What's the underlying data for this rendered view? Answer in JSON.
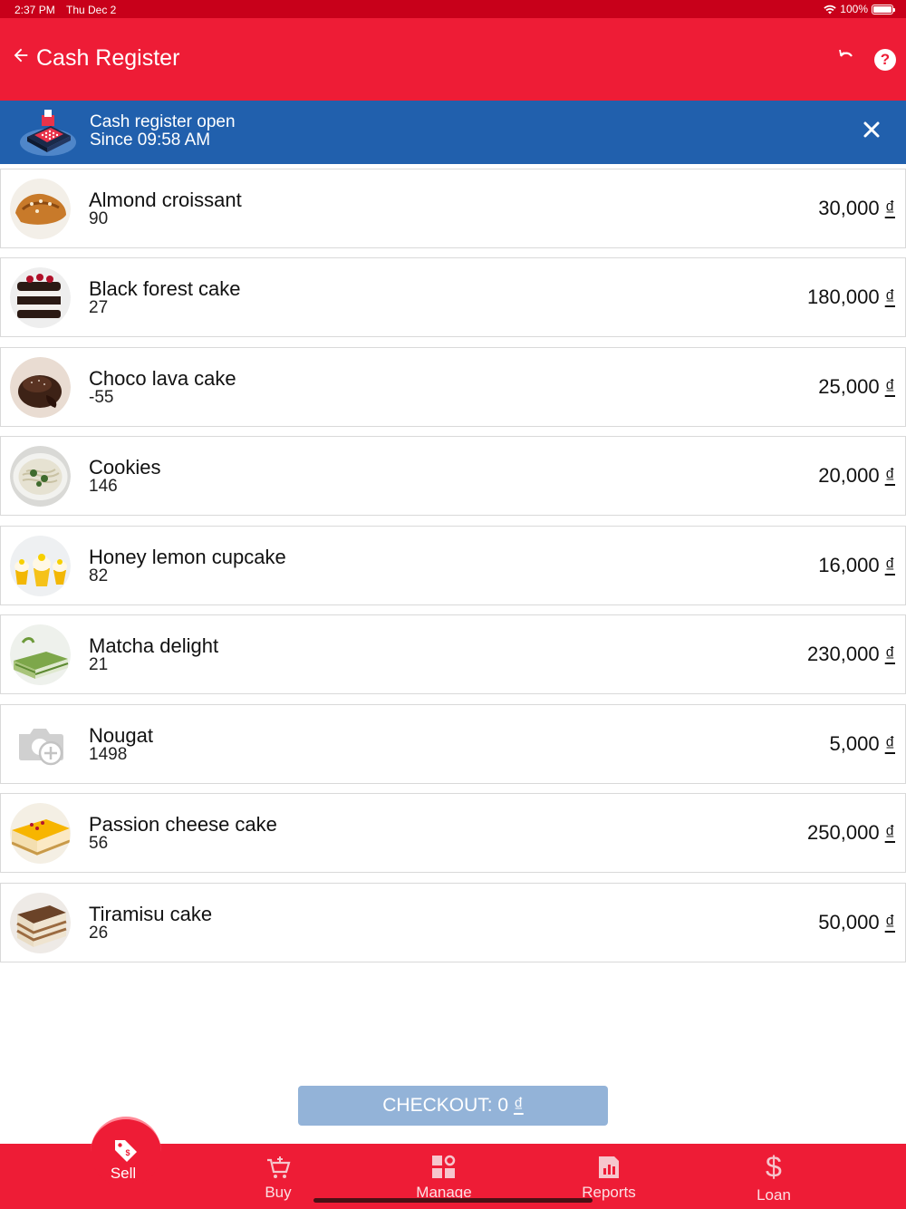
{
  "status_bar": {
    "time": "2:37 PM",
    "date": "Thu Dec 2",
    "battery": "100%"
  },
  "header": {
    "title": "Cash Register",
    "help_glyph": "?"
  },
  "banner": {
    "line1": "Cash register open",
    "line2": "Since 09:58 AM"
  },
  "products": [
    {
      "name": "Almond croissant",
      "qty": "90",
      "price": "30,000",
      "currency": "₫"
    },
    {
      "name": "Black forest cake",
      "qty": "27",
      "price": "180,000",
      "currency": "₫"
    },
    {
      "name": "Choco lava cake",
      "qty": "-55",
      "price": "25,000",
      "currency": "₫"
    },
    {
      "name": "Cookies",
      "qty": "146",
      "price": "20,000",
      "currency": "₫"
    },
    {
      "name": "Honey lemon cupcake",
      "qty": "82",
      "price": "16,000",
      "currency": "₫"
    },
    {
      "name": "Matcha delight",
      "qty": "21",
      "price": "230,000",
      "currency": "₫"
    },
    {
      "name": "Nougat",
      "qty": "1498",
      "price": "5,000",
      "currency": "₫"
    },
    {
      "name": "Passion cheese cake",
      "qty": "56",
      "price": "250,000",
      "currency": "₫"
    },
    {
      "name": "Tiramisu cake",
      "qty": "26",
      "price": "50,000",
      "currency": "₫"
    }
  ],
  "checkout": {
    "label": "CHECKOUT: 0",
    "currency": "₫"
  },
  "tabs": {
    "sell": "Sell",
    "buy": "Buy",
    "manage": "Manage",
    "reports": "Reports",
    "loan": "Loan"
  },
  "colors": {
    "brand_red": "#ee1c36",
    "banner_blue": "#2160ad",
    "checkout_disabled": "#93b3d8"
  }
}
